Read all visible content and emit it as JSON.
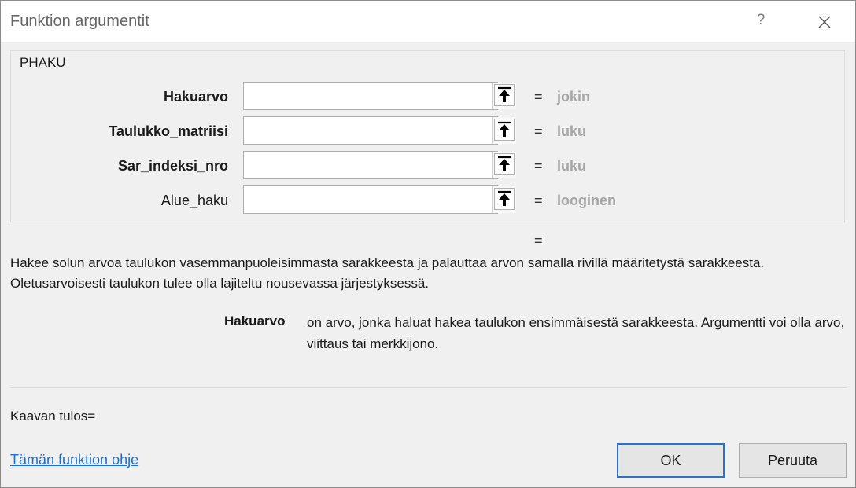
{
  "window": {
    "title": "Funktion argumentit",
    "help_label": "?",
    "close_icon": "close-icon"
  },
  "function": {
    "name": "PHAKU",
    "arguments": [
      {
        "label": "Hakuarvo",
        "bold": true,
        "value": "",
        "equals": "=",
        "type": "jokin"
      },
      {
        "label": "Taulukko_matriisi",
        "bold": true,
        "value": "",
        "equals": "=",
        "type": "luku"
      },
      {
        "label": "Sar_indeksi_nro",
        "bold": true,
        "value": "",
        "equals": "=",
        "type": "luku"
      },
      {
        "label": "Alue_haku",
        "bold": false,
        "value": "",
        "equals": "=",
        "type": "looginen"
      }
    ],
    "result_equals": "=",
    "description": "Hakee solun arvoa taulukon vasemmanpuoleisimmasta sarakkeesta ja palauttaa arvon samalla rivillä määritetystä sarakkeesta. Oletusarvoisesti taulukon tulee olla lajiteltu nousevassa järjestyksessä.",
    "argument_help": {
      "name": "Hakuarvo",
      "text": "on arvo, jonka haluat hakea taulukon ensimmäisestä sarakkeesta. Argumentti voi olla arvo, viittaus tai merkkijono."
    }
  },
  "footer": {
    "formula_result": "Kaavan tulos=",
    "help_link": "Tämän funktion ohje",
    "ok_label": "OK",
    "cancel_label": "Peruuta"
  },
  "colors": {
    "link": "#1f6fc5",
    "type_hint": "#a6a6a6",
    "ok_border": "#2b73c8"
  }
}
